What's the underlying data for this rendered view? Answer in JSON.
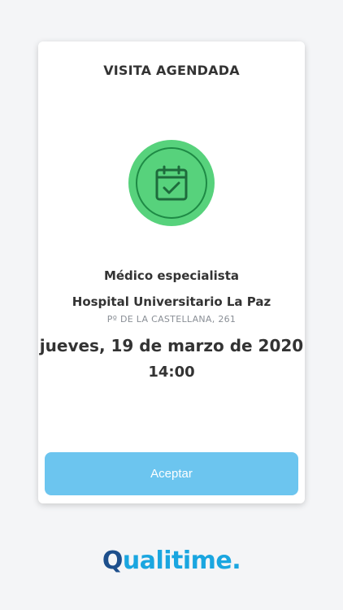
{
  "card": {
    "title": "VISITA AGENDADA",
    "icon": "calendar-check-icon",
    "specialty": "Médico especialista",
    "hospital": "Hospital Universitario La Paz",
    "address": "Pº DE LA CASTELLANA, 261",
    "date": "jueves, 19 de marzo de 2020",
    "time": "14:00",
    "accept_label": "Aceptar"
  },
  "brand": {
    "logo_first": "Q",
    "logo_rest": "ualitime.",
    "colors": {
      "primary_button": "#6cc5ef",
      "icon_green": "#57d27c",
      "logo_blue": "#1aa6e0",
      "logo_dark": "#1d4f8c"
    }
  }
}
